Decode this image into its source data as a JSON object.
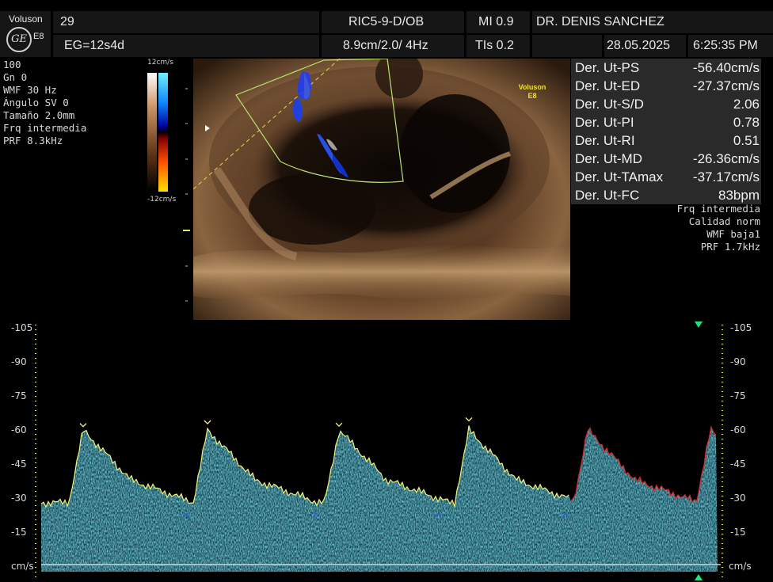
{
  "header": {
    "brand": "Voluson",
    "model": "E8",
    "ge_mark": "GE",
    "patient_id": "29",
    "gestational_age": "EG=12s4d",
    "probe": "RIC5-9-D/OB",
    "depth_info": "8.9cm/2.0/ 4Hz",
    "mi": "MI 0.9",
    "tis": "TIs 0.2",
    "doctor": "DR. DENIS SANCHEZ",
    "date": "28.05.2025",
    "time": "6:25:35 PM"
  },
  "left_params": [
    "100",
    "Gn  0",
    "WMF 30 Hz",
    "Ángulo SV  0",
    "Tamaño  2.0mm",
    "Frq intermedia",
    "PRF  8.3kHz"
  ],
  "color_bar": {
    "top_label": "12cm/s",
    "bottom_label": "-12cm/s"
  },
  "image_watermark": {
    "brand": "Voluson",
    "model": "E8"
  },
  "measurements": [
    {
      "label": "Der. Ut-PS",
      "value": "-56.40cm/s"
    },
    {
      "label": "Der. Ut-ED",
      "value": "-27.37cm/s"
    },
    {
      "label": "Der. Ut-S/D",
      "value": "2.06"
    },
    {
      "label": "Der. Ut-PI",
      "value": "0.78"
    },
    {
      "label": "Der. Ut-RI",
      "value": "0.51"
    },
    {
      "label": "Der. Ut-MD",
      "value": "-26.36cm/s"
    },
    {
      "label": "Der. Ut-TAmax",
      "value": "-37.17cm/s"
    },
    {
      "label": "Der. Ut-FC",
      "value": "83bpm"
    }
  ],
  "right_params": [
    "Frq intermedia",
    "Calidad norm",
    "WMF baja1",
    "PRF  1.7kHz"
  ],
  "doppler_scale": {
    "ticks": [
      "-105",
      "-90",
      "-75",
      "-60",
      "-45",
      "-30",
      "-15"
    ],
    "unit": "cm/s"
  },
  "colors": {
    "trace_traced": "#f2f27a",
    "trace_auto": "#d22a2a",
    "spectrum": "#2e93a8",
    "marker": "#2a62d8",
    "scale_dots": "#e8e86a"
  }
}
